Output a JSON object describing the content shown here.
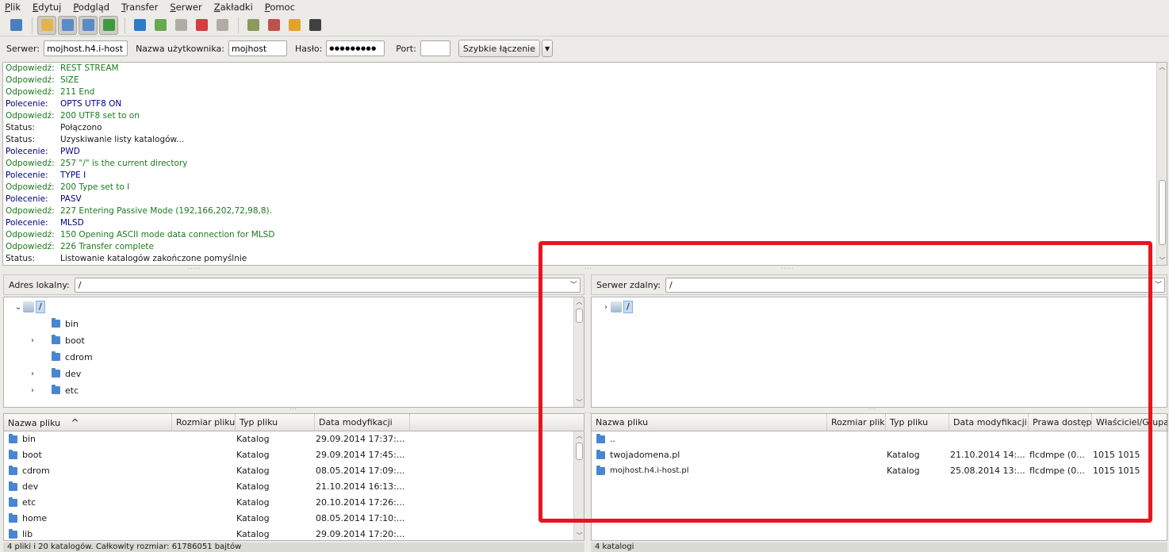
{
  "menu": [
    "Plik",
    "Edytuj",
    "Podgląd",
    "Transfer",
    "Serwer",
    "Zakładki",
    "Pomoc"
  ],
  "toolbar": {
    "groups": [
      [
        {
          "icon": "site-manager-icon",
          "color": "#4a7fbf"
        }
      ],
      [
        {
          "icon": "toggle-log-icon",
          "color": "#e0b64a",
          "pressed": true
        },
        {
          "icon": "toggle-local-tree-icon",
          "color": "#5b8ac8",
          "pressed": true
        },
        {
          "icon": "toggle-remote-tree-icon",
          "color": "#5b8ac8",
          "pressed": true
        },
        {
          "icon": "toggle-queue-icon",
          "color": "#3f9a3f",
          "pressed": true
        }
      ],
      [
        {
          "icon": "refresh-icon",
          "color": "#2c7cc9"
        },
        {
          "icon": "process-queue-icon",
          "color": "#6aa84f"
        },
        {
          "icon": "cancel-operation-icon",
          "color": "#b0aca4"
        },
        {
          "icon": "disconnect-icon",
          "color": "#d43d3d"
        },
        {
          "icon": "reconnect-icon",
          "color": "#b0aca4"
        }
      ],
      [
        {
          "icon": "directory-listing-filters-icon",
          "color": "#8a9a5b"
        },
        {
          "icon": "compare-directories-icon",
          "color": "#c0504d"
        },
        {
          "icon": "sync-browsing-icon",
          "color": "#e3a32b"
        },
        {
          "icon": "search-remote-files-icon",
          "color": "#404040"
        }
      ]
    ]
  },
  "quickconnect": {
    "server_label": "Serwer:",
    "server_value": "mojhost.h4.i-host",
    "user_label": "Nazwa użytkownika:",
    "user_value": "mojhost",
    "pass_label": "Hasło:",
    "pass_value": "●●●●●●●●●",
    "port_label": "Port:",
    "port_value": "",
    "connect_label": "Szybkie łączenie",
    "dropdown_glyph": "▼"
  },
  "log": [
    {
      "type": "resp",
      "label": "Odpowiedź:",
      "text": "REST STREAM"
    },
    {
      "type": "resp",
      "label": "Odpowiedź:",
      "text": "SIZE"
    },
    {
      "type": "resp",
      "label": "Odpowiedź:",
      "text": "211 End"
    },
    {
      "type": "cmd",
      "label": "Polecenie:",
      "text": "OPTS UTF8 ON"
    },
    {
      "type": "resp",
      "label": "Odpowiedź:",
      "text": "200 UTF8 set to on"
    },
    {
      "type": "st",
      "label": "Status:",
      "text": "Połączono"
    },
    {
      "type": "st",
      "label": "Status:",
      "text": "Uzyskiwanie listy katalogów..."
    },
    {
      "type": "cmd",
      "label": "Polecenie:",
      "text": "PWD"
    },
    {
      "type": "resp",
      "label": "Odpowiedź:",
      "text": "257 \"/\" is the current directory"
    },
    {
      "type": "cmd",
      "label": "Polecenie:",
      "text": "TYPE I"
    },
    {
      "type": "resp",
      "label": "Odpowiedź:",
      "text": "200 Type set to I"
    },
    {
      "type": "cmd",
      "label": "Polecenie:",
      "text": "PASV"
    },
    {
      "type": "resp",
      "label": "Odpowiedź:",
      "text": "227 Entering Passive Mode (192,166,202,72,98,8)."
    },
    {
      "type": "cmd",
      "label": "Polecenie:",
      "text": "MLSD"
    },
    {
      "type": "resp",
      "label": "Odpowiedź:",
      "text": "150 Opening ASCII mode data connection for MLSD"
    },
    {
      "type": "resp",
      "label": "Odpowiedź:",
      "text": "226 Transfer complete"
    },
    {
      "type": "st",
      "label": "Status:",
      "text": "Listowanie katalogów zakończone pomyślnie"
    }
  ],
  "local": {
    "address_label": "Adres lokalny:",
    "address_value": "/",
    "tree": [
      {
        "name": "/",
        "expander": "⌄",
        "root": true
      },
      {
        "name": "bin",
        "expander": ""
      },
      {
        "name": "boot",
        "expander": "›"
      },
      {
        "name": "cdrom",
        "expander": ""
      },
      {
        "name": "dev",
        "expander": "›"
      },
      {
        "name": "etc",
        "expander": "›"
      }
    ],
    "columns": [
      "Nazwa pliku",
      "Rozmiar pliku",
      "Typ pliku",
      "Data modyfikacji"
    ],
    "sort_glyph": "^",
    "files": [
      {
        "name": "bin",
        "type": "Katalog",
        "date": "29.09.2014 17:37:..."
      },
      {
        "name": "boot",
        "type": "Katalog",
        "date": "29.09.2014 17:45:..."
      },
      {
        "name": "cdrom",
        "type": "Katalog",
        "date": "08.05.2014 17:09:..."
      },
      {
        "name": "dev",
        "type": "Katalog",
        "date": "21.10.2014 16:13:..."
      },
      {
        "name": "etc",
        "type": "Katalog",
        "date": "20.10.2014 17:26:..."
      },
      {
        "name": "home",
        "type": "Katalog",
        "date": "08.05.2014 17:10:..."
      },
      {
        "name": "lib",
        "type": "Katalog",
        "date": "29.09.2014 17:20:..."
      }
    ],
    "status": "4 pliki i 20 katalogów. Całkowity rozmiar: 61786051 bajtów"
  },
  "remote": {
    "address_label": "Serwer zdalny:",
    "address_value": "/",
    "tree": [
      {
        "name": "/",
        "expander": "›",
        "root": true
      }
    ],
    "columns": [
      "Nazwa pliku",
      "Rozmiar pliku",
      "Typ pliku",
      "Data modyfikacji",
      "Prawa dostępu",
      "Właściciel/Grupa"
    ],
    "files": [
      {
        "name": "..",
        "type": "",
        "date": "",
        "perms": "",
        "owner": ""
      },
      {
        "name": "twojadomena.pl",
        "type": "Katalog",
        "date": "21.10.2014 14:...",
        "perms": "flcdmpe (0...",
        "owner": "1015 1015"
      },
      {
        "name": "mojhost.h4.i-host.pl",
        "type": "Katalog",
        "date": "25.08.2014 13:...",
        "perms": "flcdmpe (0...",
        "owner": "1015 1015"
      }
    ],
    "status": "4 katalogi"
  },
  "scroll": {
    "up": "︿",
    "down": "﹀"
  },
  "colors": {
    "highlight_box": "#e8141e",
    "folder": "#4a86d0",
    "response": "#1c7a1c",
    "command": "#00007a"
  }
}
